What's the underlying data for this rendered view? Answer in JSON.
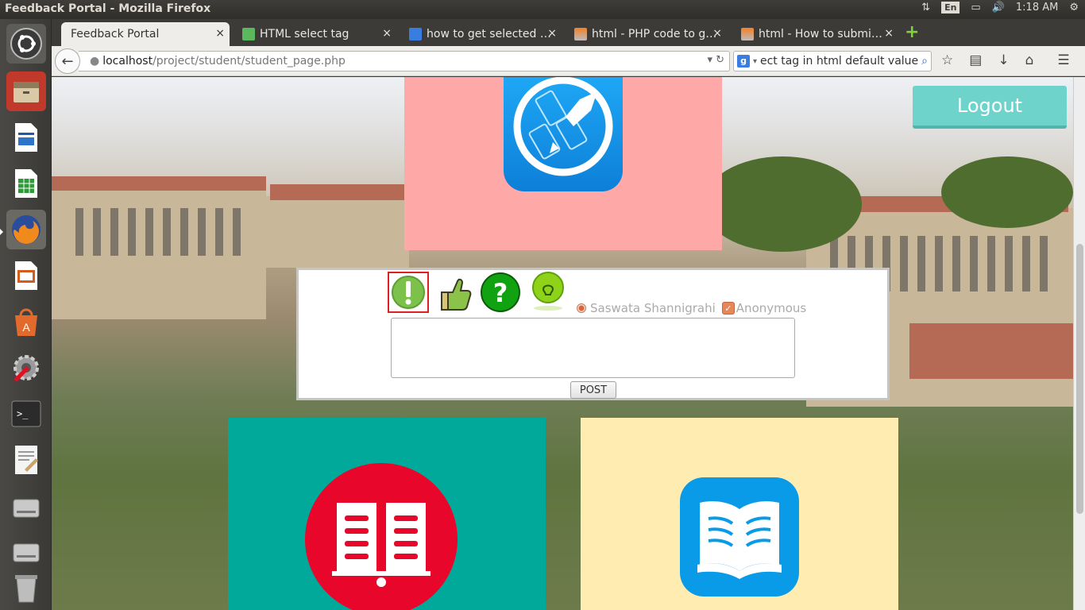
{
  "window": {
    "title": "Feedback Portal - Mozilla Firefox"
  },
  "panel": {
    "lang": "En",
    "time": "1:18 AM"
  },
  "launcher": {
    "items": [
      "ubuntu-dash",
      "files",
      "writer",
      "calc",
      "firefox",
      "impress",
      "software-center",
      "system-settings",
      "terminal",
      "text-editor",
      "drive",
      "drive",
      "trash"
    ]
  },
  "tabs": [
    {
      "label": "Feedback Portal",
      "active": true
    },
    {
      "label": "HTML select tag",
      "active": false
    },
    {
      "label": "how to get selected …",
      "active": false
    },
    {
      "label": "html - PHP code to g…",
      "active": false
    },
    {
      "label": "html - How to submi…",
      "active": false
    }
  ],
  "url": {
    "host": "localhost",
    "path": "/project/student/student_page.php"
  },
  "search": {
    "value": "select tag in html default value"
  },
  "page": {
    "logout_label": "Logout",
    "feedback": {
      "types": [
        "warning",
        "like",
        "question",
        "idea"
      ],
      "selected_type": "warning",
      "radio_label": "Saswata Shannigrahi",
      "checkbox_label": "Anonymous",
      "post_label": "POST",
      "text_value": ""
    }
  },
  "colors": {
    "pink_panel": "#ffa8a8",
    "teal_panel": "#00a99a",
    "cream_panel": "#ffecb0",
    "logout": "#6ed3ca"
  }
}
